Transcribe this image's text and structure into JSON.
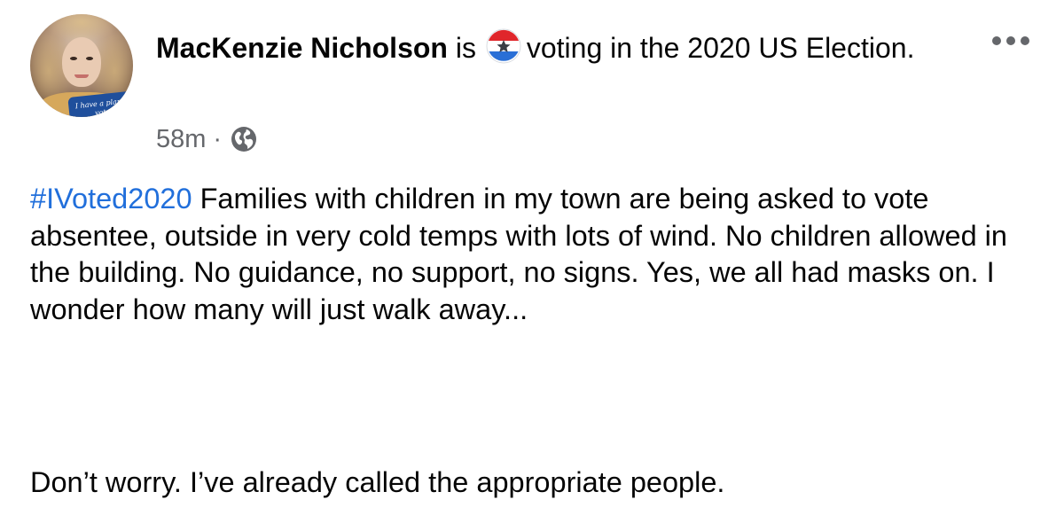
{
  "post": {
    "author_name": "MacKenzie Nicholson",
    "activity_prefix": " is ",
    "activity_text": "voting in the 2020 US Election.",
    "activity_badge_icon": "election-star-badge-icon",
    "avatar_banner_text": "I have a plan to vote!",
    "timestamp": "58m",
    "separator": "·",
    "audience_icon": "globe-icon",
    "hashtag": "#IVoted2020",
    "body_text": " Families with children in my town are being asked to vote absentee, outside in very cold temps with lots of wind. No children allowed in the building. No guidance, no support, no signs. Yes, we all had masks on. I wonder how many will just walk away...",
    "closing_text": "Don’t worry. I’ve already called the appropriate people.",
    "more_options_icon": "more-horizontal-icon"
  },
  "colors": {
    "text": "#050505",
    "secondary_text": "#65676b",
    "link": "#216fdb",
    "badge_red": "#e0262b",
    "badge_blue": "#2a6fd6"
  }
}
